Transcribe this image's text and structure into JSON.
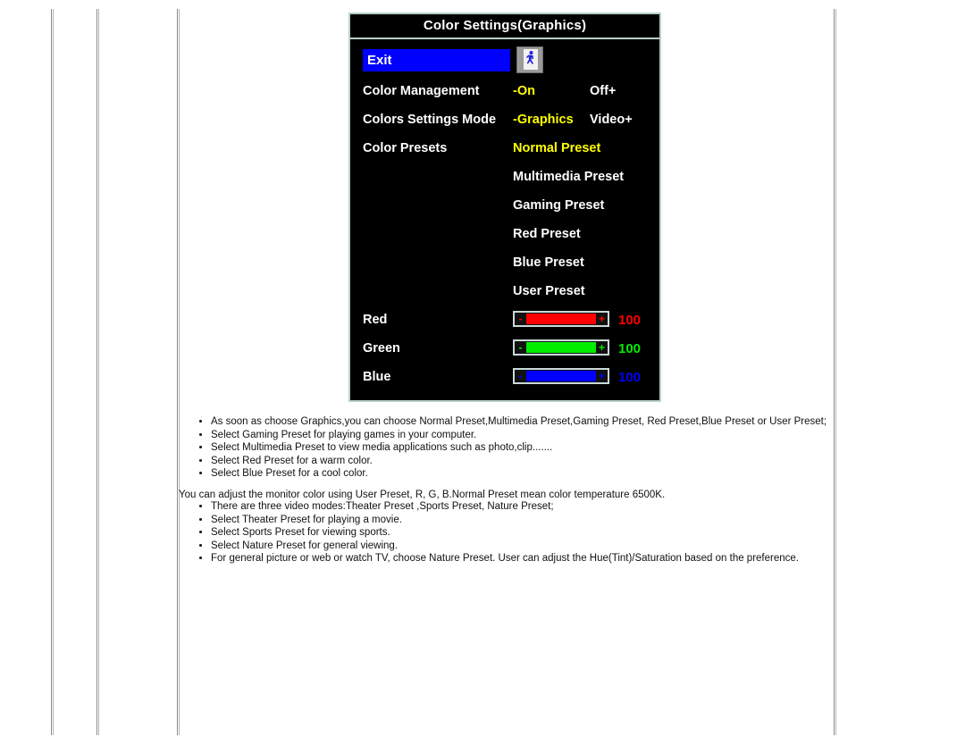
{
  "osd": {
    "title": "Color Settings(Graphics)",
    "exit": {
      "label": "Exit",
      "icon": "exit-door-running-person-icon"
    },
    "rows": [
      {
        "label": "Color Management",
        "value": "-On",
        "value_selected": true,
        "value2": "Off+"
      },
      {
        "label": "Colors Settings Mode",
        "value": "-Graphics",
        "value_selected": true,
        "value2": "Video+"
      },
      {
        "label": "Color Presets",
        "value": "Normal Preset",
        "value_selected": true,
        "value2": ""
      }
    ],
    "presets": [
      "Multimedia Preset",
      "Gaming Preset",
      "Red Preset",
      "Blue Preset",
      "User Preset"
    ],
    "sliders": [
      {
        "label": "Red",
        "value": "100",
        "color": "#ff0000",
        "minus": "-",
        "plus": "+"
      },
      {
        "label": "Green",
        "value": "100",
        "color": "#00ee00",
        "minus": "-",
        "plus": "+"
      },
      {
        "label": "Blue",
        "value": "100",
        "color": "#0000ff",
        "minus": "-",
        "plus": "+"
      }
    ],
    "colors": {
      "panel_border": "#b8d0cc",
      "background": "#000000",
      "label": "#ffffff",
      "selected_value": "#ffff00",
      "highlight": "#0000ff"
    }
  },
  "doc": {
    "bullets_one": [
      "As soon as choose Graphics,you can choose Normal Preset,Multimedia Preset,Gaming Preset, Red Preset,Blue Preset or User Preset;",
      "Select Gaming Preset for playing games in your computer.",
      "Select Multimedia Preset to view media applications such as photo,clip.......",
      "Select Red Preset for a warm color.",
      "Select Blue Preset for a cool color."
    ],
    "paragraph": "You can adjust the monitor color using User Preset, R, G, B.Normal Preset mean color temperature 6500K.",
    "bullets_two": [
      "There are three video modes:Theater Preset ,Sports Preset, Nature Preset;",
      "Select Theater Preset for playing a movie.",
      "Select Sports Preset for viewing sports.",
      "Select Nature Preset for general viewing.",
      "For general picture or web or watch TV, choose Nature Preset. User can adjust the Hue(Tint)/Saturation based on the preference."
    ]
  }
}
